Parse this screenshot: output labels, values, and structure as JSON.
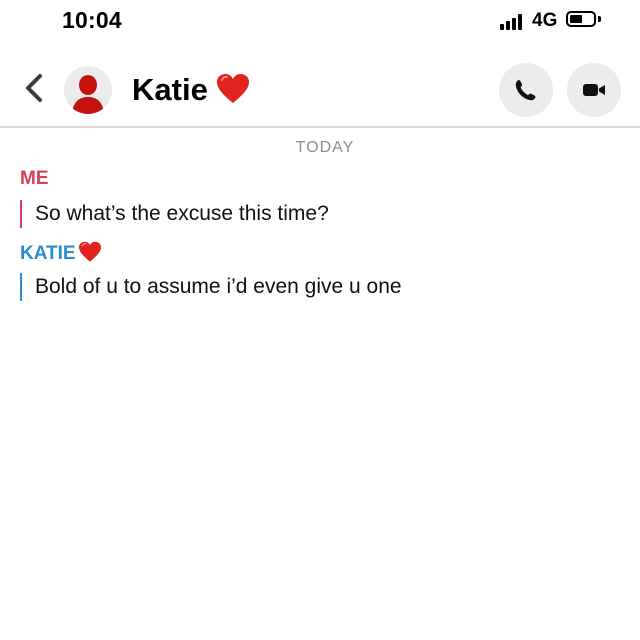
{
  "status_bar": {
    "time": "10:04",
    "network": "4G",
    "battery_level": 0.55,
    "signal_bars": 4
  },
  "header": {
    "back_icon": "chevron-left-icon",
    "avatar_icon": "person-silhouette-icon",
    "contact_name": "Katie",
    "name_emoji": "heart-emoji",
    "call_icon": "phone-icon",
    "video_icon": "video-camera-icon"
  },
  "conversation": {
    "day_label": "TODAY",
    "messages": [
      {
        "sender": "ME",
        "text": "So what’s the excuse this time?",
        "color": "#d4405d"
      },
      {
        "sender": "KATIE",
        "sender_emoji": "heart-emoji",
        "text": "Bold of u to assume i’d even give u one",
        "color": "#2a8bd0"
      }
    ]
  },
  "colors": {
    "heart": "#e0231e",
    "avatar": "#c4120c",
    "button_bg": "#ececec",
    "divider": "#d8d8d8"
  }
}
